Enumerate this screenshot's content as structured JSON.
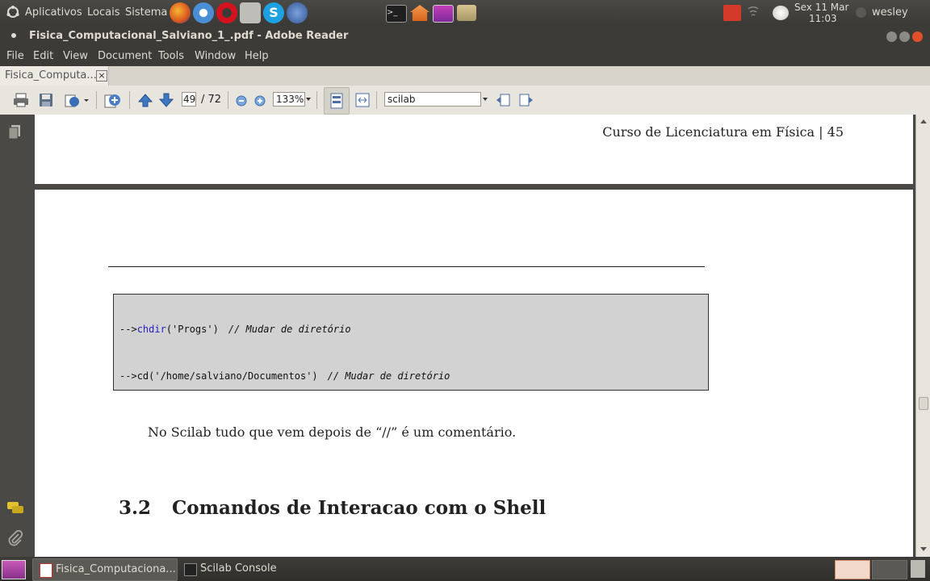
{
  "top_panel": {
    "apps_label": "Aplicativos",
    "places_label": "Locais",
    "system_label": "Sistema",
    "datetime_day": "Sex 11 Mar",
    "datetime_time": "11:03",
    "user": "wesley"
  },
  "window": {
    "title": "Fisica_Computacional_Salviano_1_.pdf - Adobe Reader"
  },
  "menu": {
    "file": "File",
    "edit": "Edit",
    "view": "View",
    "document": "Document",
    "tools": "Tools",
    "window": "Window",
    "help": "Help"
  },
  "tab": {
    "label": "Fisica_Computa...",
    "close": "×"
  },
  "toolbar": {
    "page_current": "49",
    "page_total": "/ 72",
    "zoom": "133%",
    "search_text": "scilab"
  },
  "document": {
    "header": "Curso de Licenciatura em Física | 45",
    "code": {
      "line1_prompt": "-->",
      "line1_func": "chdir",
      "line1_args": "('Progs')",
      "line1_comment": "// Mudar de diretório",
      "line2_prompt": "-->",
      "line2_code": "cd('/home/salviano/Documentos')",
      "line2_comment": "// Mudar de diretório"
    },
    "paragraph": "No Scilab tudo que vem depois de “//” é um comentário.",
    "section_number": "3.2",
    "section_title": "Comandos de Interacao com o Shell"
  },
  "taskbar": {
    "task1": "Fisica_Computaciona...",
    "task2": "Scilab Console"
  }
}
